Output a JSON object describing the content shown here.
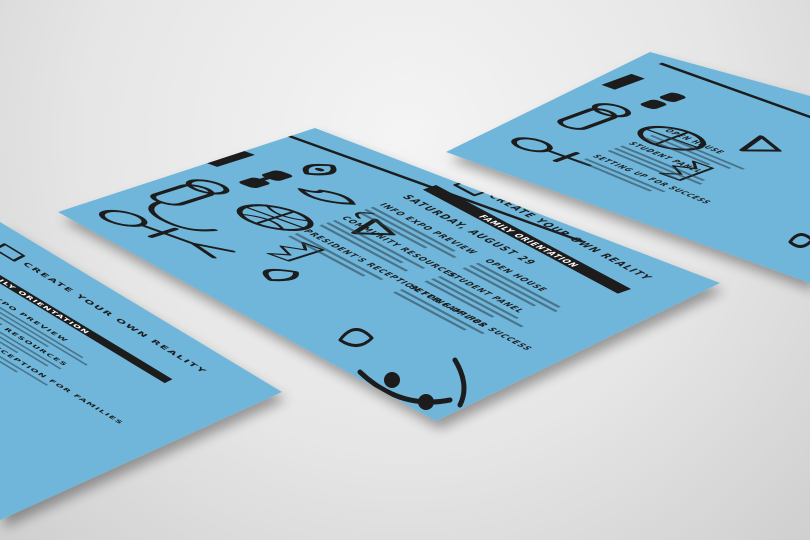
{
  "flyer": {
    "headline": "CREATE YOUR OWN REALITY",
    "banner": "FAMILY ORIENTATION",
    "date_line": "SATURDAY, AUGUST 29",
    "sections": [
      "INFO EXPO PREVIEW",
      "COMMUNITY RESOURCES",
      "PRESIDENT'S RECEPTION FOR FAMILIES",
      "OPEN HOUSE",
      "STUDENT PANEL",
      "SETTING UP FOR SUCCESS"
    ]
  },
  "colors": {
    "paper": "#6fb6da",
    "ink": "#1c1c1c",
    "background": "#e6e6e6"
  },
  "icons": [
    "person-icon",
    "microphone-icon",
    "sunglasses-icon",
    "basketball-icon",
    "crown-icon",
    "flame-icon",
    "torch-icon",
    "smiley-icon",
    "leaf-icon",
    "camera-icon"
  ]
}
